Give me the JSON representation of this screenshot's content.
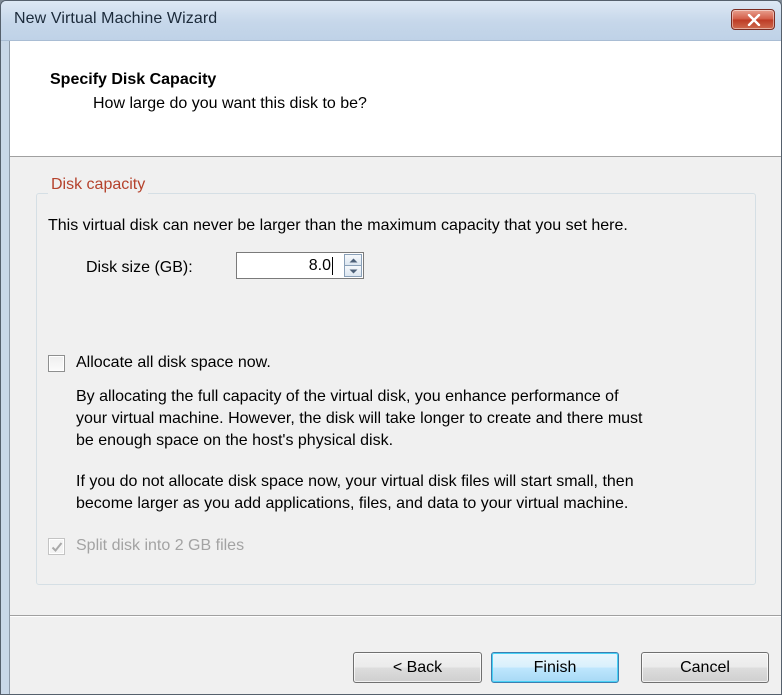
{
  "window": {
    "title": "New Virtual Machine Wizard"
  },
  "header": {
    "title": "Specify Disk Capacity",
    "subtitle": "How large do you want this disk to be?"
  },
  "disk_capacity": {
    "group_label": "Disk capacity",
    "description": "This virtual disk can never be larger than the maximum capacity that you set here.",
    "disk_size_label": "Disk size (GB):",
    "disk_size_value": "8.0"
  },
  "allocate": {
    "label": "Allocate all disk space now.",
    "checked": false,
    "para1_lines": [
      "By allocating the full capacity of the virtual disk, you enhance performance of",
      "your virtual machine.  However, the disk will take longer to create and there must",
      "be enough space on the host's physical disk."
    ],
    "para2_lines": [
      "If you do not allocate disk space now, your virtual disk files will start small, then",
      "become larger as you add applications, files, and data to your virtual machine."
    ]
  },
  "split": {
    "label": "Split disk into 2 GB files",
    "checked": true,
    "enabled": false
  },
  "buttons": {
    "back": "< Back",
    "finish": "Finish",
    "cancel": "Cancel"
  },
  "icons": {
    "close": "close-icon",
    "spin_up": "chevron-up-icon",
    "spin_down": "chevron-down-icon",
    "check": "checkmark-icon"
  },
  "colors": {
    "group_label": "#b5422c",
    "disabled_text": "#a3a3a3",
    "close_button": "#c9432c"
  }
}
